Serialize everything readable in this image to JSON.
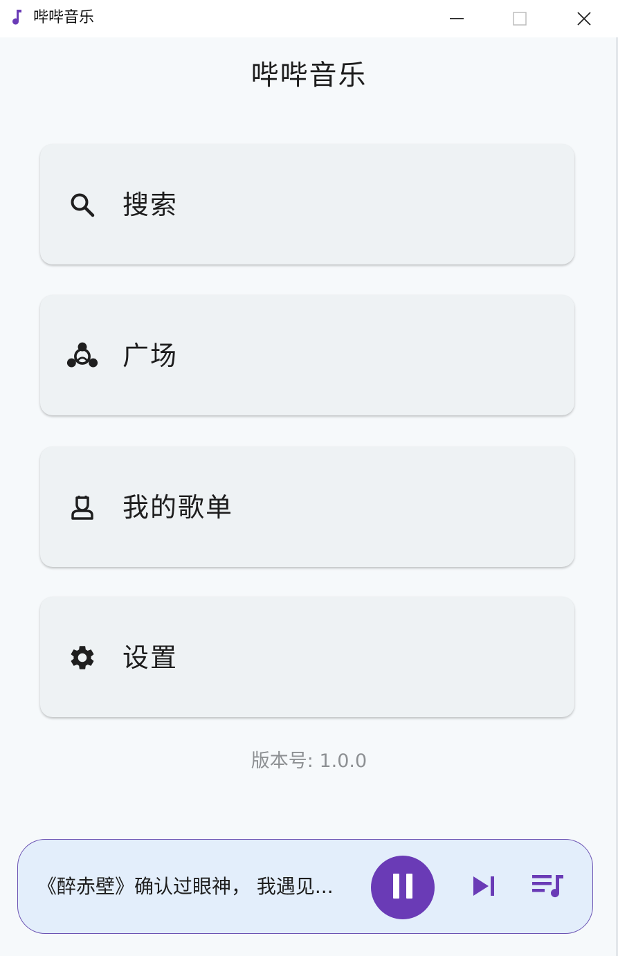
{
  "window": {
    "title": "哔哔音乐",
    "app_icon": "music-note-icon",
    "controls": [
      "minimize-icon",
      "maximize-icon",
      "close-icon"
    ]
  },
  "page": {
    "title": "哔哔音乐"
  },
  "menu": {
    "items": [
      {
        "label": "搜索",
        "icon": "search-icon"
      },
      {
        "label": "广场",
        "icon": "community-icon"
      },
      {
        "label": "我的歌单",
        "icon": "user-icon"
      },
      {
        "label": "设置",
        "icon": "gear-icon"
      }
    ]
  },
  "footer": {
    "version": "版本号: 1.0.0"
  },
  "player": {
    "now_playing": "《醉赤壁》确认过眼神， 我遇见...",
    "play_state": "playing",
    "controls": [
      "pause-icon",
      "skip-next-icon",
      "queue-music-icon"
    ]
  },
  "colors": {
    "accent": "#6a3bb6",
    "player_bg": "#e3eefb",
    "player_border": "#6b53b3",
    "card_bg": "#eef2f4",
    "page_bg": "#f6f9fb",
    "icon_dark": "#1f1f1f",
    "muted_text": "#8d9093"
  }
}
